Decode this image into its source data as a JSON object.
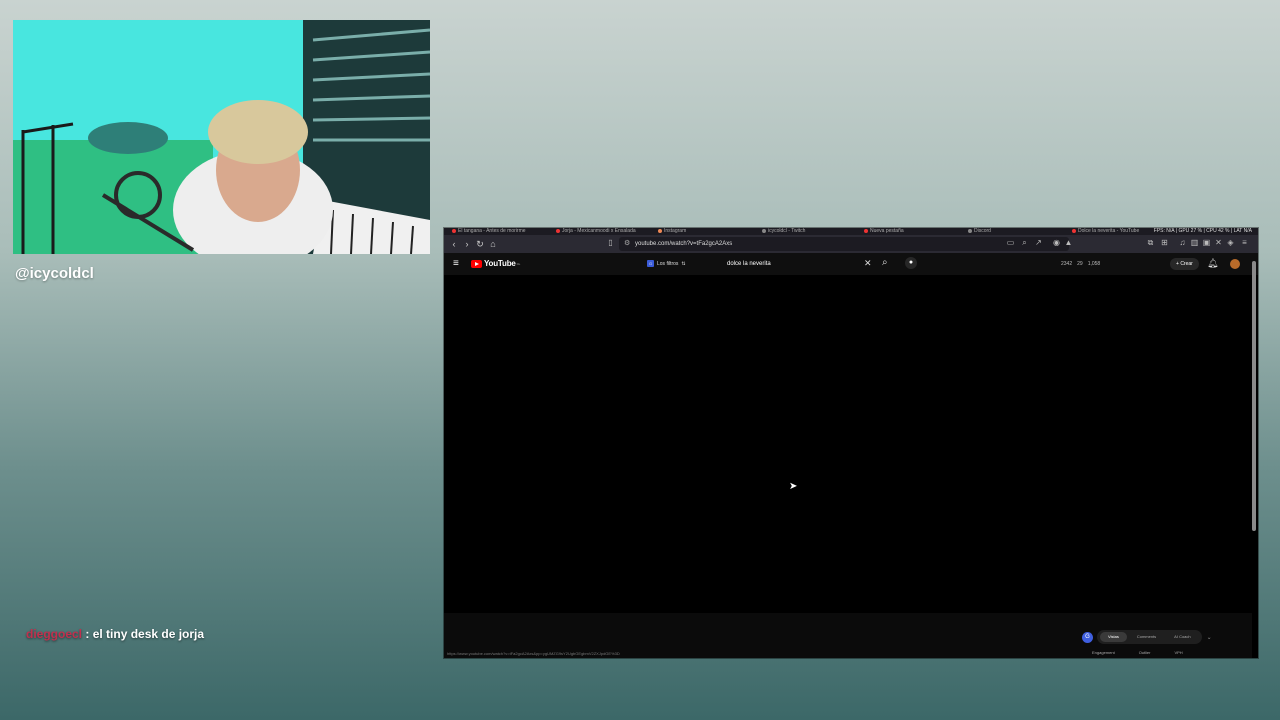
{
  "overlay": {
    "handle": "@icycoldcl",
    "chat": {
      "user": "dieggoecl",
      "separator": " : ",
      "message": "el tiny desk de jorja"
    }
  },
  "browser": {
    "tabs": [
      "El tangana - Antes de morirme",
      "Jorja - Mexicanmoodi x Ensalada",
      "Instagram",
      "icycoldcl - Twitch",
      "Nueva pestaña",
      "Discord",
      "Dolce la neverita - YouTube"
    ],
    "system_stats": {
      "fps": "FPS: N/A",
      "gpu": "GPU 27 %",
      "cpu": "CPU 42 %",
      "lat": "LAT N/A"
    },
    "url": "youtube.com/watch?v=tFa2gcA2Axs",
    "status_url": "https://www.youtube.com/watch?v=tFa2gcA2Axs&pp=ygUMZG9sY2UgbGEgbmV2ZXJpdGE%3D"
  },
  "youtube": {
    "logo_text": "YouTube",
    "logo_country": "CL",
    "filters_label": "Los filtros",
    "search_value": "dolce la neverita",
    "counters": [
      "2342",
      "29",
      "1,058"
    ],
    "create_label": "Crear",
    "widget": {
      "options": [
        "Vistas",
        "Comments",
        "AI Coach"
      ],
      "labels": [
        "Engagement",
        "Outlier",
        "VPH"
      ]
    }
  }
}
